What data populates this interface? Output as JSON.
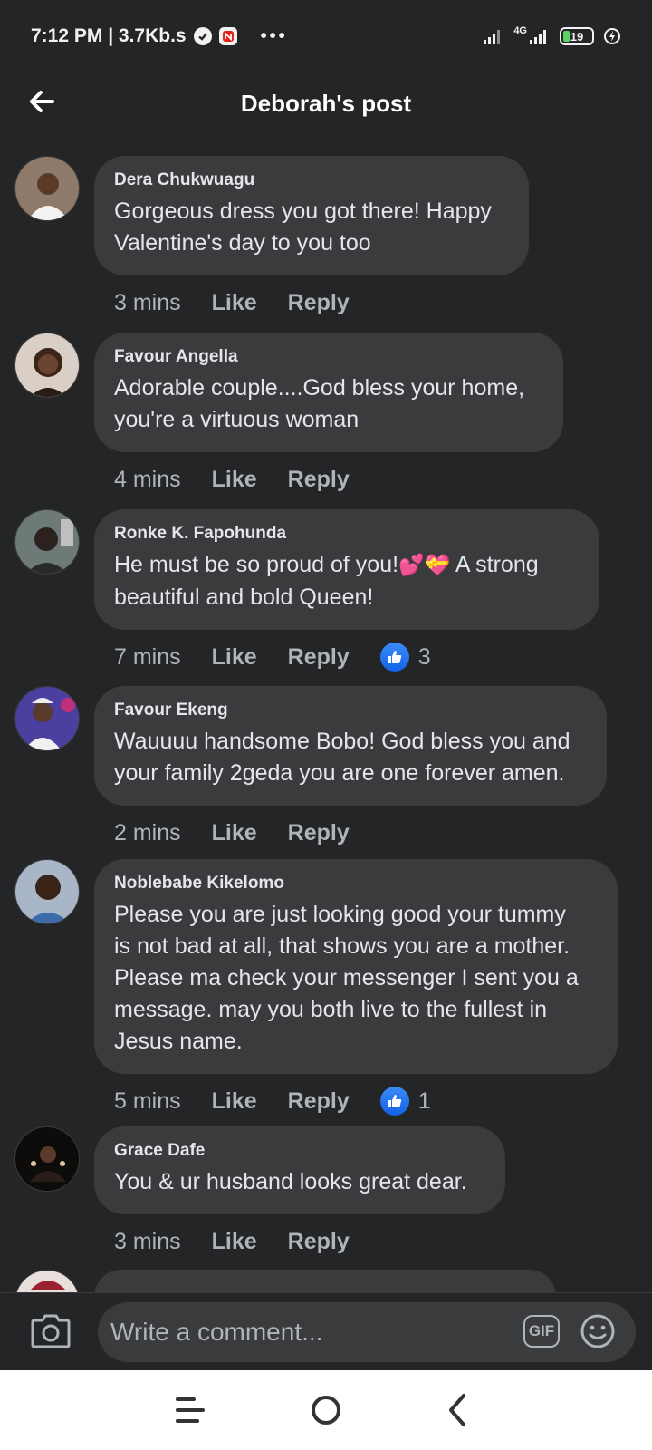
{
  "status_bar": {
    "time": "7:12 PM | 3.7Kb.s",
    "dots": "•••",
    "network": "4G",
    "battery": "19"
  },
  "header": {
    "title": "Deborah's post"
  },
  "comments": [
    {
      "author": "Dera Chukwuagu",
      "text_lines": [
        "Gorgeous dress you got there! Happy",
        "Valentine's day to you too"
      ],
      "time": "3 mins",
      "like_label": "Like",
      "reply_label": "Reply",
      "avatar_color": "#c9b7a6"
    },
    {
      "author": "Favour Angella",
      "text_lines": [
        "Adorable couple....God bless your home,",
        "you're a virtuous woman"
      ],
      "time": "4 mins",
      "like_label": "Like",
      "reply_label": "Reply",
      "avatar_color": "#7a5a52"
    },
    {
      "author": "Ronke K. Fapohunda",
      "text_lines": [
        "He must be so proud of you!",
        "beautiful and bold Queen!"
      ],
      "text_line1_tail": " A strong",
      "emojis": "💕💝",
      "time": "7 mins",
      "like_label": "Like",
      "reply_label": "Reply",
      "reaction_count": "3",
      "avatar_color": "#5a6b6e"
    },
    {
      "author": "Favour Ekeng",
      "text_lines": [
        "Wauuuu handsome Bobo! God bless you and",
        "your family 2geda you are one forever amen."
      ],
      "time": "2 mins",
      "like_label": "Like",
      "reply_label": "Reply",
      "avatar_color": "#5b4aa8"
    },
    {
      "author": "Noblebabe Kikelomo",
      "text_lines": [
        "Please you are just looking good your tummy",
        "is not bad at all, that shows you are a mother.",
        "Please ma check your messenger I sent you a",
        "message. may you both live to the  fullest in",
        "Jesus name."
      ],
      "time": "5 mins",
      "like_label": "Like",
      "reply_label": "Reply",
      "reaction_count": "1",
      "avatar_color": "#4a5e7a"
    },
    {
      "author": "Grace Dafe",
      "text_lines": [
        "You & ur husband looks great dear."
      ],
      "time": "3 mins",
      "like_label": "Like",
      "reply_label": "Reply",
      "avatar_color": "#1a1512"
    }
  ],
  "composer": {
    "placeholder": "Write a comment...",
    "gif_label": "GIF"
  },
  "colors": {
    "background": "#242526",
    "bubble": "#3a3b3c",
    "primary_text": "#e4e6eb",
    "secondary_text": "#b0b3b8",
    "like_blue": "#1877f2"
  },
  "icons": {
    "back": "arrow-left-icon",
    "camera": "camera-icon",
    "emoji": "smiley-icon",
    "like": "thumbs-up-icon",
    "nav_recents": "menu-lines-icon",
    "nav_home": "circle-home-icon",
    "nav_back": "chevron-left-icon"
  }
}
